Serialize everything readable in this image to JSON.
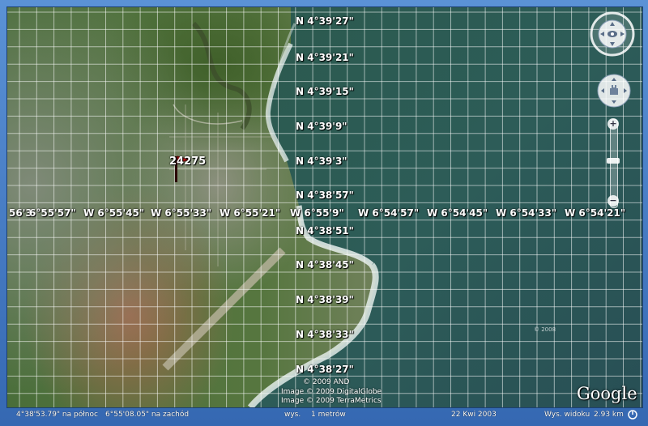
{
  "map": {
    "latitude_labels": [
      "N 4°39'27\"",
      "N 4°39'21\"",
      "N 4°39'15\"",
      "N 4°39'9\"",
      "N 4°39'3\"",
      "N 4°38'57\"",
      "N 4°38'51\"",
      "N 4°38'45\"",
      "N 4°38'39\"",
      "N 4°38'33\"",
      "N 4°38'27\""
    ],
    "longitude_labels": [
      "56'3",
      "6°55'57\"",
      "W 6°55'45\"",
      "W 6°55'33\"",
      "W 6°55'21\"",
      "W 6°55'9\"",
      "W 6°54'57\"",
      "W 6°54'45\"",
      "W 6°54'33\"",
      "W 6°54'21\""
    ],
    "marker_label": "24275",
    "copyrights": [
      "© 2009 AND",
      "Image © 2009 DigitalGlobe",
      "Image © 2009 TerraMetrics"
    ],
    "small_copy": "© 2008",
    "logo_text": "Google",
    "colors": {
      "sea": "#2f5d5a",
      "grid": "#ffffff",
      "frame": "#3c6fb8",
      "marker": "#b01212"
    }
  },
  "status": {
    "latitude": "4°38'53.79\" na północ",
    "longitude": "6°55'08.05\" na zachód",
    "elev_label": "wys.",
    "elev_value": "1 metrów",
    "date": "22 Kwi 2003",
    "eye_label": "Wys. widoku",
    "eye_value": "2.93 km"
  },
  "icons": {
    "navigation": "compass-ring-icon",
    "pan": "hand-pan-icon",
    "zoom_in": "plus-icon",
    "zoom_out": "minus-icon",
    "marker": "red-flag-icon"
  }
}
